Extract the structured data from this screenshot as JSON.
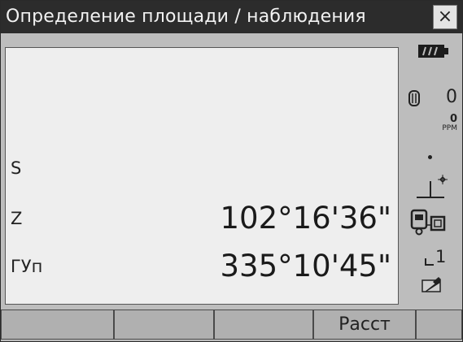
{
  "window": {
    "title": "Определение площади / наблюдения",
    "close_label": "×"
  },
  "measurements": [
    {
      "label": "S",
      "value": ""
    },
    {
      "label": "Z",
      "value": "102°16'36\""
    },
    {
      "label": "ГУп",
      "value": "335°10'45\""
    }
  ],
  "status": {
    "prism_constant": "0",
    "ppm_value": "0",
    "ppm_unit": "PPM",
    "face_indicator": "1"
  },
  "softkeys": [
    "",
    "",
    "",
    "Расст",
    ""
  ]
}
